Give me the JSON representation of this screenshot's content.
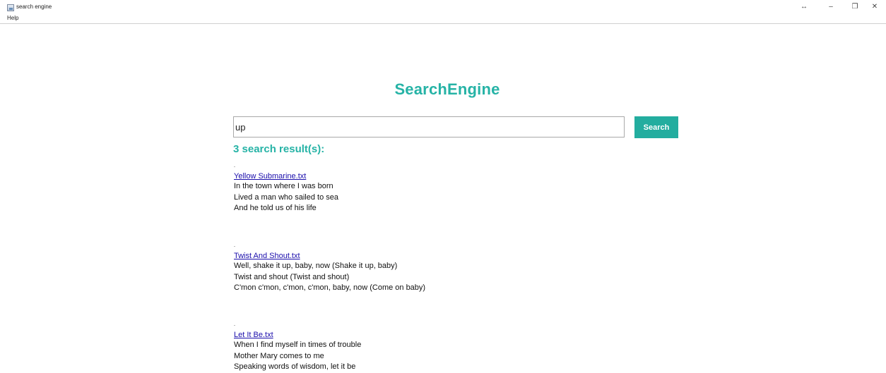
{
  "window": {
    "title": "search engine",
    "controls": {
      "resize": "↔",
      "minimize": "–",
      "restore": "❐",
      "close": "✕"
    }
  },
  "menu": {
    "items": [
      "Help"
    ]
  },
  "header": {
    "brand": "SearchEngine"
  },
  "search": {
    "query": "up",
    "button_label": "Search"
  },
  "results": {
    "count_text": "3 search result(s):",
    "items": [
      {
        "title": "Yellow Submarine.txt",
        "lines": [
          "In the town where I was born",
          "Lived a man who sailed to sea",
          "And he told us of his life"
        ]
      },
      {
        "title": "Twist And Shout.txt",
        "lines": [
          "Well, shake it up, baby, now (Shake it up, baby)",
          "Twist and shout (Twist and shout)",
          "C'mon c'mon, c'mon, c'mon, baby, now (Come on baby)"
        ]
      },
      {
        "title": "Let It Be.txt",
        "lines": [
          "When I find myself in times of trouble",
          "Mother Mary comes to me",
          "Speaking words of wisdom, let it be"
        ]
      }
    ]
  },
  "colors": {
    "accent": "#26b3a6",
    "button": "#23ad9f",
    "link": "#1a0dab"
  }
}
